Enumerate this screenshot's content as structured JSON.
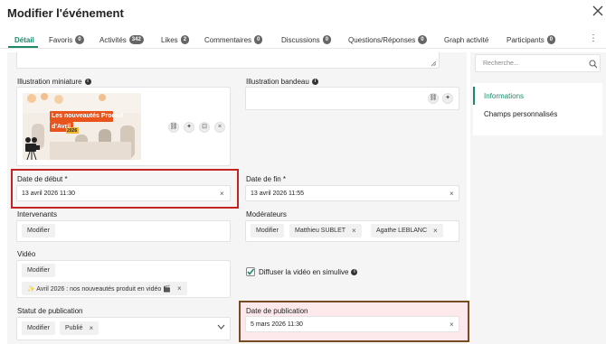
{
  "header": {
    "title": "Modifier l'événement"
  },
  "tabs": [
    {
      "label": "Détail"
    },
    {
      "label": "Favoris",
      "count": "0"
    },
    {
      "label": "Activités",
      "count": "342"
    },
    {
      "label": "Likes",
      "count": "2"
    },
    {
      "label": "Commentaires",
      "count": "0"
    },
    {
      "label": "Discussions",
      "count": "0"
    },
    {
      "label": "Questions/Réponses",
      "count": "0"
    },
    {
      "label": "Graph activité"
    },
    {
      "label": "Participants",
      "count": "0"
    }
  ],
  "form": {
    "thumbnail": {
      "label": "Illustration miniature",
      "image_text_line1": "Les nouveautés Produit",
      "image_text_line2": "d'Avril",
      "image_badge": "2026"
    },
    "banner": {
      "label": "Illustration bandeau"
    },
    "start_date": {
      "label": "Date de début *",
      "value": "13 avril 2026 11:30"
    },
    "end_date": {
      "label": "Date de fin *",
      "value": "13 avril 2026 11:55"
    },
    "speakers": {
      "label": "Intervenants",
      "button": "Modifier"
    },
    "moderators": {
      "label": "Modérateurs",
      "button": "Modifier",
      "chips": [
        "Matthieu SUBLET",
        "Agathe LEBLANC"
      ]
    },
    "video": {
      "label": "Vidéo",
      "button": "Modifier",
      "chip": "✨ Avril 2026 : nos nouveautés produit en vidéo 🎬"
    },
    "simulive": {
      "label": "Diffuser la vidéo en simulive",
      "checked": true
    },
    "publication_status": {
      "label": "Statut de publication",
      "button": "Modifier",
      "chip": "Publié"
    },
    "publication_date": {
      "label": "Date de publication",
      "value": "5 mars 2026 11:30"
    }
  },
  "sidebar": {
    "search_placeholder": "Recherche...",
    "items": [
      {
        "label": "Informations",
        "active": true
      },
      {
        "label": "Champs personnalisés",
        "active": false
      }
    ]
  },
  "colors": {
    "accent": "#1d8a6a",
    "highlight_red": "#c22323",
    "highlight_brown": "#7a4a22",
    "image_orange": "#e8541c"
  }
}
